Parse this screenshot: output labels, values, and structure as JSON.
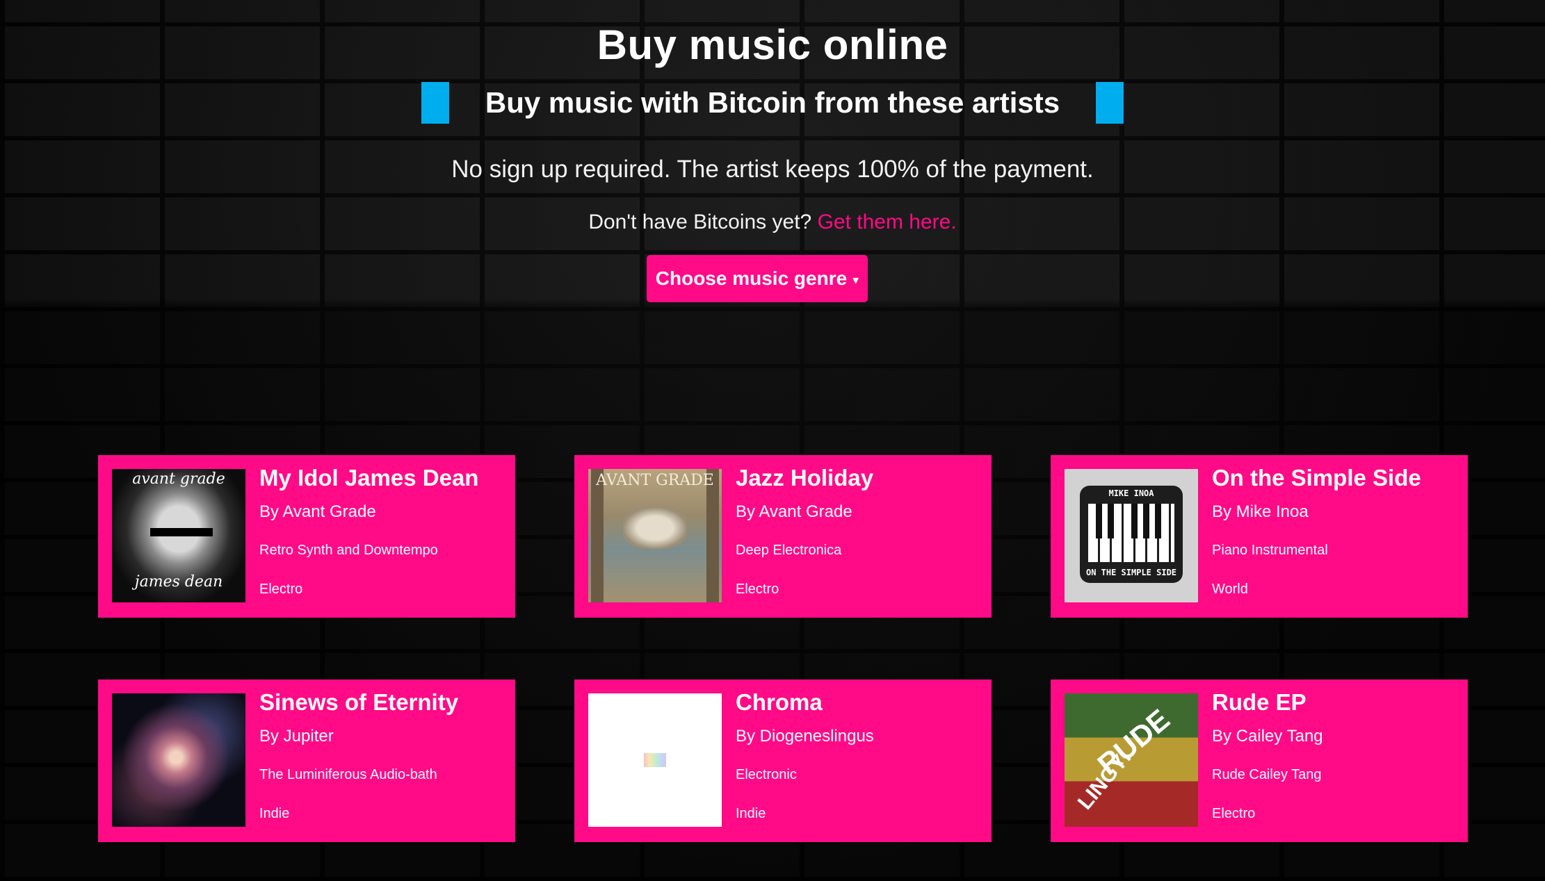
{
  "hero": {
    "title": "Buy music online",
    "subtitle": "Buy music with Bitcoin from these artists",
    "tagline": "No sign up required. The artist keeps 100% of the payment.",
    "btc_prompt": "Don't have Bitcoins yet?",
    "btc_link": "Get them here.",
    "genre_button": "Choose music genre",
    "caret": "▾"
  },
  "colors": {
    "accent_pink": "#ff0a87",
    "accent_blue": "#00aeef",
    "background": "#050505"
  },
  "albums": [
    {
      "title": "My Idol James Dean",
      "artist": "By Avant Grade",
      "album": "Retro Synth and Downtempo",
      "genre": "Electro",
      "cover_top": "avant grade",
      "cover_bottom": "james dean"
    },
    {
      "title": "Jazz Holiday",
      "artist": "By Avant Grade",
      "album": "Deep Electronica",
      "genre": "Electro",
      "cover_text": "AVANT GRADE"
    },
    {
      "title": "On the Simple Side",
      "artist": "By Mike Inoa",
      "album": "Piano Instrumental",
      "genre": "World",
      "cover_top": "MIKE INOA",
      "cover_bottom": "ON THE SIMPLE SIDE"
    },
    {
      "title": "Sinews of Eternity",
      "artist": "By Jupiter",
      "album": "The Luminiferous Audio-bath",
      "genre": "Indie"
    },
    {
      "title": "Chroma",
      "artist": "By Diogeneslingus",
      "album": "Electronic",
      "genre": "Indie"
    },
    {
      "title": "Rude EP",
      "artist": "By Cailey Tang",
      "album": "Rude Cailey Tang",
      "genre": "Electro",
      "cover_text1": "RUDE",
      "cover_text2": "LINGYI"
    }
  ]
}
